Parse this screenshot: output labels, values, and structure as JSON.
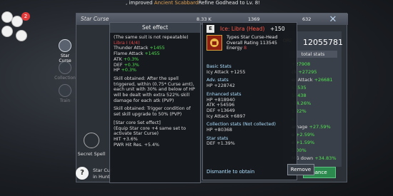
{
  "ticker": {
    "prefix": ", improved",
    "item": "Ancient Scabbard",
    "suffix": "Refine Godhead to Lv. 8!"
  },
  "badge_count": "2",
  "window": {
    "title": "Star Curse",
    "res1": "8.33 K",
    "res2": "1369",
    "res3": "632"
  },
  "tabs": [
    {
      "label": "Star Curse"
    },
    {
      "label": "Collection"
    },
    {
      "label": "Train"
    }
  ],
  "secret_spell": "Secret Spell",
  "bottom_note": [
    "Star Cur",
    "in Hunt"
  ],
  "background_panel": {
    "score_icon": "ORE",
    "score": "12055781",
    "total_stats": "total stats",
    "lines": [
      {
        "text": "",
        "value": "+27908"
      },
      {
        "text": "ck",
        "value": "+27295"
      },
      {
        "text": "er Attack",
        "value": "+26681"
      },
      {
        "text": "",
        "value": "53535"
      },
      {
        "text": "",
        "value": "59438"
      },
      {
        "text": "",
        "value": "-34.26%"
      },
      {
        "text": "",
        "value": "5.22%"
      },
      {
        "text": "",
        "value": "e"
      },
      {
        "text": "amage",
        "value": "+27.59%"
      },
      {
        "text": "e",
        "value": "+2.59%"
      },
      {
        "text": "e",
        "value": "+1.59%"
      },
      {
        "text": "",
        "value": "5.00%"
      },
      {
        "text": "MG down",
        "value": "+34.83%"
      }
    ]
  },
  "set_effect": {
    "title": "Set effect",
    "note": "(The same suit is not repeatable)",
    "set_name": "Libra I (4/4)",
    "stats": [
      {
        "label": "Thunder Attack",
        "value": "+1455"
      },
      {
        "label": "Flame Attack",
        "value": "+1455"
      },
      {
        "label": "ATK",
        "value": "+0.3%"
      },
      {
        "label": "DEF",
        "value": "+0.3%"
      },
      {
        "label": "HP",
        "value": "+0.3%"
      }
    ],
    "skill1": "Skill obtained: After the spell triggered, within (0.75* Curse amt), each unit with 30% and below of HP will be dealt with extra 522% skill damage for each atk (PVP)",
    "skill2": "Skill obtained: Trigger condition of set skill upgrade to 50% (PVP)",
    "star_core": "[Star core Set effect]",
    "star_core_desc": "(Equip Star core +4 same set to activate Star Curse)",
    "hit": "HIT +3.6%",
    "pwr": "PWR Hit Res. +5.4%"
  },
  "item": {
    "rank": "E",
    "name": "Ice: Libra (Head)",
    "plus": "+150",
    "type_line": "Types Star Curse-Head",
    "rating": "Overall Rating 113545",
    "energy_label": "Energy",
    "energy_value": "8",
    "basic_title": "Basic Stats",
    "basic": [
      "Icy Attack +1255"
    ],
    "adv_title": "Adv. stats",
    "adv": [
      "HP +228742"
    ],
    "enh_title": "Enhanced stats",
    "enh": [
      "HP +818940",
      "ATK +54596",
      "DEF +13649",
      "Icy Attack +6897"
    ],
    "coll_title": "Collection stats (Not collected)",
    "coll": [
      "HP +80368"
    ],
    "star_title": "Star stats",
    "star": [
      "DEF +1.39%"
    ],
    "dismantle": "Dismantle to obtain"
  },
  "buttons": {
    "remove": "Remove",
    "enhance": "hance"
  },
  "colors": {
    "item_name": "#ff5a4a",
    "green": "#4fe34f",
    "section": "#aee1ff",
    "enhance_button": "#2c8a4f"
  }
}
